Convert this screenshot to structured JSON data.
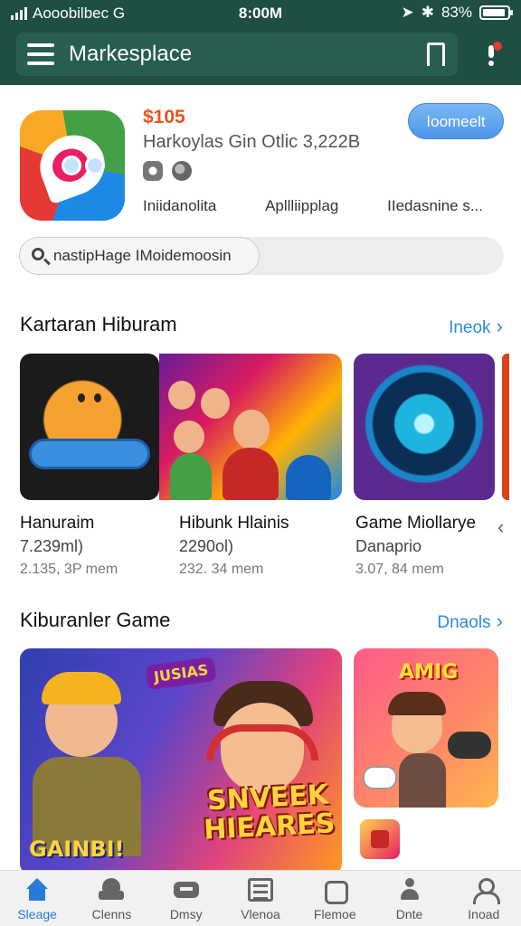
{
  "status_bar": {
    "carrier": "Aooobilbec G",
    "time": "8:00M",
    "battery": "83%",
    "icons": [
      "signal-icon",
      "location-icon",
      "bluetooth-icon",
      "battery-icon"
    ]
  },
  "header": {
    "title": "Markesplace",
    "icons": [
      "menu-icon",
      "bookmark-icon",
      "notification-icon"
    ]
  },
  "featured": {
    "price": "$105",
    "name": "Harkoylas Gin Otlic 3,222B",
    "install_label": "Ioomeelt",
    "meta": [
      "Iniidanolita",
      "Apllliipplag",
      "IIedasnine s..."
    ]
  },
  "search": {
    "value": "nastipHage IMoidemoosin"
  },
  "sections": [
    {
      "title": "Kartaran Hiburam",
      "link": "Ineok",
      "items": [
        {
          "name": "Hanuraim",
          "sub": "7.239ml)",
          "small": "2.135, 3P mem"
        },
        {
          "name": "Hibunk Hlainis",
          "sub": "2290ol)",
          "small": "232. 34 mem"
        },
        {
          "name": "Game Miollarye",
          "sub": "Danaprio",
          "small": "3.07, 84 mem"
        }
      ]
    },
    {
      "title": "Kiburanler Game",
      "link": "Dnaols",
      "banner_texts": {
        "logo": "SNVEEK HIEARES",
        "badge": "JUSIAS",
        "corner": "GAINBI!",
        "side": "AMIG"
      }
    }
  ],
  "tabs": [
    {
      "label": "Sleage",
      "icon": "home-icon",
      "active": true
    },
    {
      "label": "Clenns",
      "icon": "games-icon",
      "active": false
    },
    {
      "label": "Dmsy",
      "icon": "gamepad-icon",
      "active": false
    },
    {
      "label": "Vlenoa",
      "icon": "grid-icon",
      "active": false
    },
    {
      "label": "Flemoe",
      "icon": "puzzle-icon",
      "active": false
    },
    {
      "label": "Dnte",
      "icon": "person-icon",
      "active": false
    },
    {
      "label": "Inoad",
      "icon": "profile-icon",
      "active": false
    }
  ],
  "colors": {
    "header_bg": "#1f4e43",
    "accent_blue": "#2a8cd8",
    "price_orange": "#e8531d"
  }
}
